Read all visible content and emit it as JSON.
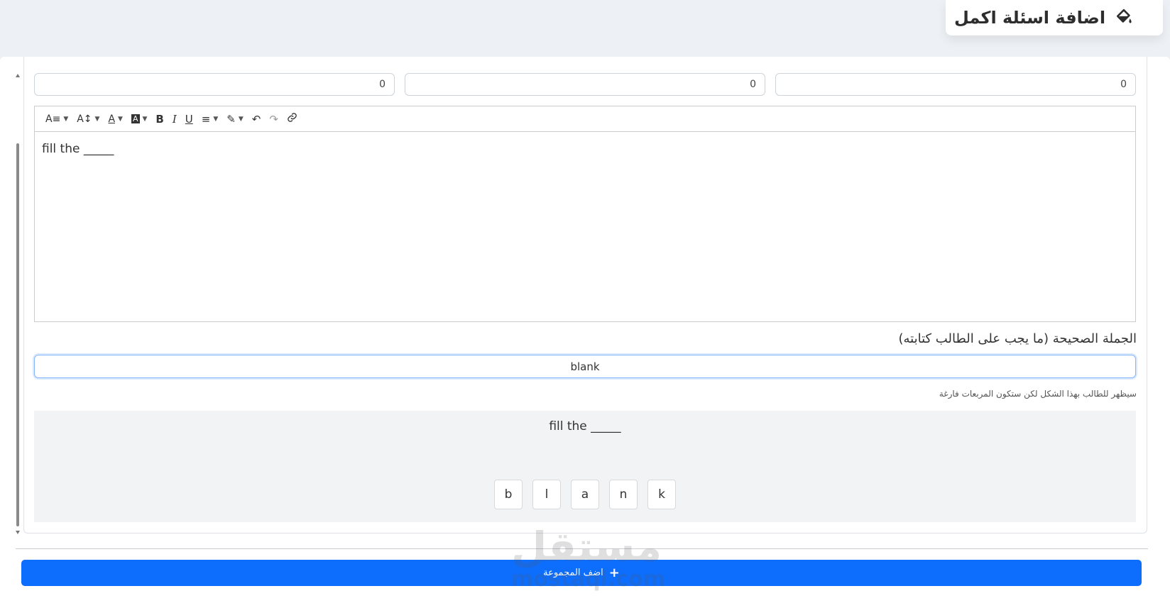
{
  "header": {
    "title": "اضافة اسئلة اكمل",
    "icon": "paint-bucket-icon"
  },
  "score_inputs": [
    "0",
    "0",
    "0"
  ],
  "editor": {
    "toolbar": [
      {
        "name": "font-family-icon",
        "label": "A≡",
        "dropdown": true
      },
      {
        "name": "font-size-icon",
        "label": "A↕",
        "dropdown": true
      },
      {
        "name": "font-color-icon",
        "label": "A",
        "dropdown": true
      },
      {
        "name": "background-color-icon",
        "label": "A",
        "dropdown": true
      },
      {
        "name": "bold-icon",
        "label": "B",
        "dropdown": false
      },
      {
        "name": "italic-icon",
        "label": "I",
        "dropdown": false
      },
      {
        "name": "underline-icon",
        "label": "U",
        "dropdown": false
      },
      {
        "name": "align-icon",
        "label": "≡",
        "dropdown": true
      },
      {
        "name": "highlight-icon",
        "label": "✎",
        "dropdown": true
      },
      {
        "name": "undo-icon",
        "label": "↶",
        "dropdown": false
      },
      {
        "name": "redo-icon",
        "label": "↷",
        "dropdown": false
      },
      {
        "name": "link-icon",
        "label": "🔗",
        "dropdown": false
      }
    ],
    "content": "fill the _____"
  },
  "answer": {
    "label": "الجملة الصحيحة (ما يجب على الطالب كتابته)",
    "value": "blank"
  },
  "hint": "سيظهر للطالب بهذا الشكل لكن ستكون المربعات فارغة",
  "preview": {
    "text": "fill the _____",
    "letters": [
      "b",
      "l",
      "a",
      "n",
      "k"
    ]
  },
  "add_group_button": "اضف المجموعة",
  "watermark": {
    "arabic": "مستقل",
    "latin": "mostaql.com"
  }
}
